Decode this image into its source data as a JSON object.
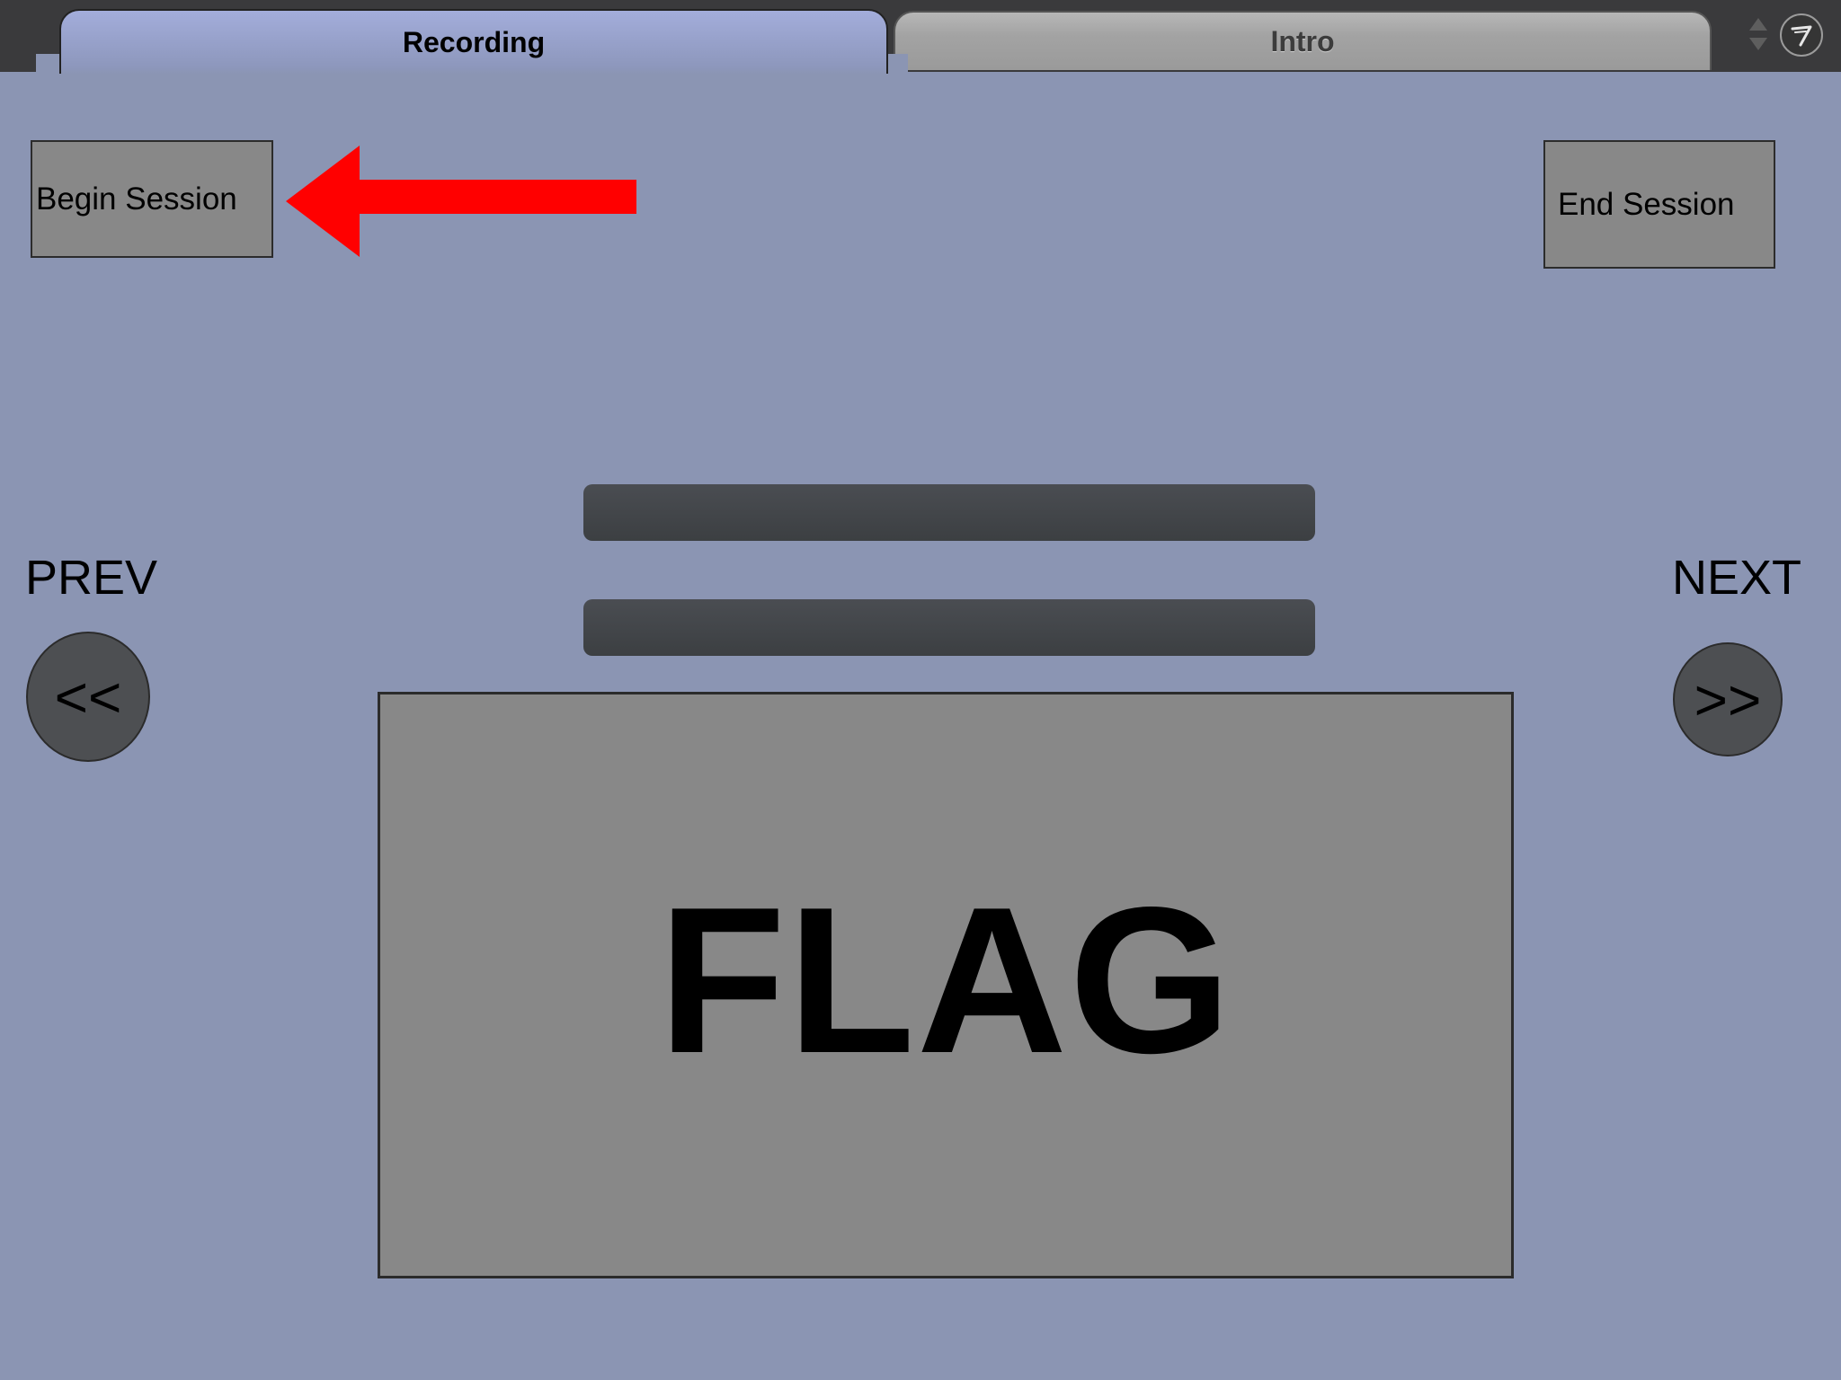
{
  "tabs": [
    {
      "label": "Recording",
      "active": true
    },
    {
      "label": "Intro",
      "active": false
    }
  ],
  "header": {
    "stepper_icon": "up-down-stepper-icon",
    "logo_icon": "app-logo-icon"
  },
  "session": {
    "begin_label": "Begin Session",
    "end_label": "End Session"
  },
  "annotation": {
    "arrow_icon": "left-arrow-icon",
    "arrow_color": "#ff0000"
  },
  "navigation": {
    "prev_label": "PREV",
    "next_label": "NEXT",
    "prev_button": "<<",
    "next_button": ">>"
  },
  "card": {
    "word": "FLAG"
  },
  "colors": {
    "background": "#8b95b3",
    "button_fill": "#888888",
    "bar_fill": "#3f4245",
    "active_tab": "#a3addb",
    "inactive_tab": "#a3a3a3"
  }
}
